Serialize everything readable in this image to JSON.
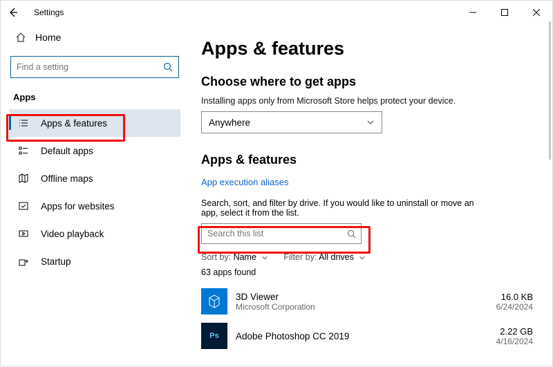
{
  "titlebar": {
    "title": "Settings"
  },
  "sidebar": {
    "home": "Home",
    "searchPlaceholder": "Find a setting",
    "category": "Apps",
    "items": [
      {
        "label": "Apps & features",
        "selected": true
      },
      {
        "label": "Default apps"
      },
      {
        "label": "Offline maps"
      },
      {
        "label": "Apps for websites"
      },
      {
        "label": "Video playback"
      },
      {
        "label": "Startup"
      }
    ]
  },
  "main": {
    "pageTitle": "Apps & features",
    "section1": {
      "heading": "Choose where to get apps",
      "hint": "Installing apps only from Microsoft Store helps protect your device.",
      "dropdownValue": "Anywhere"
    },
    "section2": {
      "heading": "Apps & features",
      "link": "App execution aliases",
      "desc": "Search, sort, and filter by drive. If you would like to uninstall or move an app, select it from the list.",
      "searchPlaceholder": "Search this list",
      "sortLabel": "Sort by:",
      "sortValue": "Name",
      "filterLabel": "Filter by:",
      "filterValue": "All drives",
      "count": "63 apps found",
      "apps": [
        {
          "name": "3D Viewer",
          "publisher": "Microsoft Corporation",
          "size": "16.0 KB",
          "date": "6/24/2024",
          "iconBg": "#0078d4"
        },
        {
          "name": "Adobe Photoshop CC 2019",
          "publisher": "",
          "size": "2.22 GB",
          "date": "4/16/2024",
          "iconBg": "#001b33",
          "iconText": "Ps"
        }
      ]
    }
  }
}
